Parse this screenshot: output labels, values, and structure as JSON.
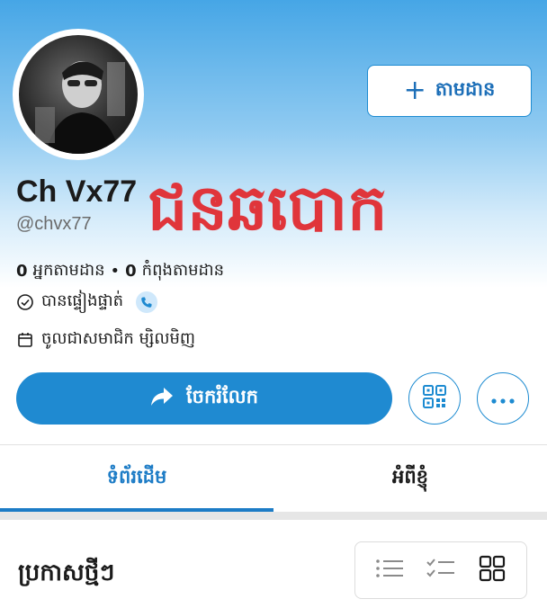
{
  "profile": {
    "display_name": "Ch Vx77",
    "handle": "@chvx77",
    "scam_label": "ជនឆបោក",
    "followers_count": "0",
    "followers_label": "អ្នកតាមដាន",
    "separator": "•",
    "following_count": "0",
    "following_label": "កំពុងតាមដាន",
    "verified_text": "បានផ្ទៀងផ្ទាត់",
    "joined_text": "ចូលជាសមាជិក ម្សិលមិញ"
  },
  "actions": {
    "follow_label": "តាមដាន",
    "share_label": "ចែករំលែក"
  },
  "tabs": [
    {
      "label": "ទំព័រដើម",
      "active": true
    },
    {
      "label": "អំពីខ្ញុំ",
      "active": false
    }
  ],
  "section": {
    "title": "ប្រកាសថ្មីៗ"
  },
  "view_toggle": {
    "options": [
      "list-icon",
      "checklist-icon",
      "grid-icon"
    ],
    "selected": "grid-icon"
  },
  "colors": {
    "accent": "#1f8ad1",
    "scam_red": "#e0353b"
  }
}
